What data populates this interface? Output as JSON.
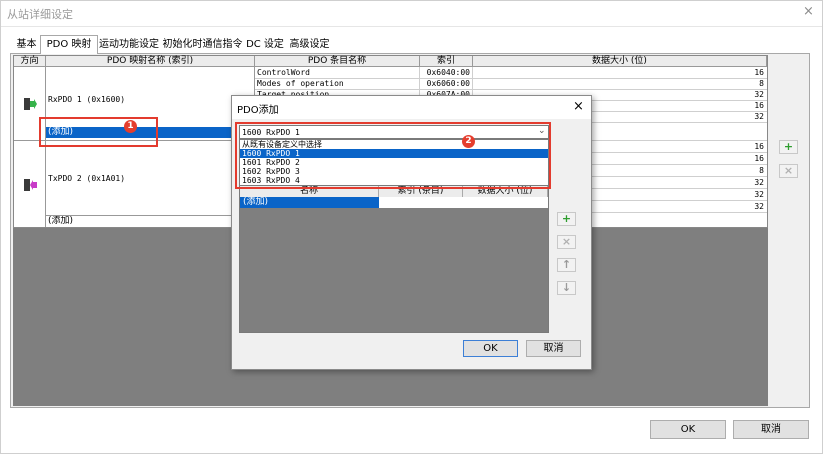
{
  "window": {
    "title": "从站详细设定",
    "close_glyph": "×"
  },
  "tabs": [
    {
      "label": "基本"
    },
    {
      "label": "PDO 映射"
    },
    {
      "label": "运动功能设定"
    },
    {
      "label": "初始化时通信指令"
    },
    {
      "label": "DC 设定"
    },
    {
      "label": "高级设定"
    }
  ],
  "grid": {
    "headers": [
      "方向",
      "PDO 映射名称 (索引)",
      "PDO 条目名称",
      "索引",
      "数据大小 (位)"
    ],
    "rxpdo_label": "RxPDO 1 (0x1600)",
    "txpdo_label": "TxPDO 2 (0x1A01)",
    "add_label_1": "(添加)",
    "add_label_2": "(添加)",
    "rows": [
      {
        "entry": "ControlWord",
        "index": "0x6040:00",
        "size": "16"
      },
      {
        "entry": "Modes of operation",
        "index": "0x6060:00",
        "size": "8"
      },
      {
        "entry": "Target position",
        "index": "0x607A:00",
        "size": "32"
      },
      {
        "entry": "",
        "index": "",
        "size": "16"
      },
      {
        "entry": "",
        "index": "",
        "size": "32"
      },
      {
        "entry": "",
        "index": "",
        "size": ""
      },
      {
        "entry": "",
        "index": "",
        "size": "16"
      },
      {
        "entry": "",
        "index": "",
        "size": "16"
      },
      {
        "entry": "",
        "index": "",
        "size": "8"
      },
      {
        "entry": "",
        "index": "",
        "size": "32"
      },
      {
        "entry": "",
        "index": "",
        "size": "32"
      },
      {
        "entry": "",
        "index": "",
        "size": "32"
      }
    ]
  },
  "side_buttons": {
    "add": "+",
    "remove": "×"
  },
  "footer": {
    "ok_label": "OK",
    "cancel_label": "取消"
  },
  "badges": {
    "one": "1",
    "two": "2"
  },
  "dialog": {
    "title": "PDO添加",
    "close_glyph": "×",
    "combo_value": "1600 RxPDO 1",
    "combo_arrow": "⌄",
    "options": [
      {
        "label": "从既有设备定义中选择"
      },
      {
        "label": "1600 RxPDO 1"
      },
      {
        "label": "1601 RxPDO 2"
      },
      {
        "label": "1602 RxPDO 3"
      },
      {
        "label": "1603 RxPDO 4"
      }
    ],
    "list_headers": [
      "名称",
      "索引 (条目)",
      "数据大小 (位)"
    ],
    "list_add_label": "(添加)",
    "buttons": {
      "add": "+",
      "remove": "×",
      "up": "↑",
      "down": "↓"
    },
    "ok_label": "OK",
    "cancel_label": "取消"
  },
  "colors": {
    "selection": "#0a64c8",
    "highlight_box": "#e33b2e",
    "plus_green": "#2e9d2e"
  }
}
